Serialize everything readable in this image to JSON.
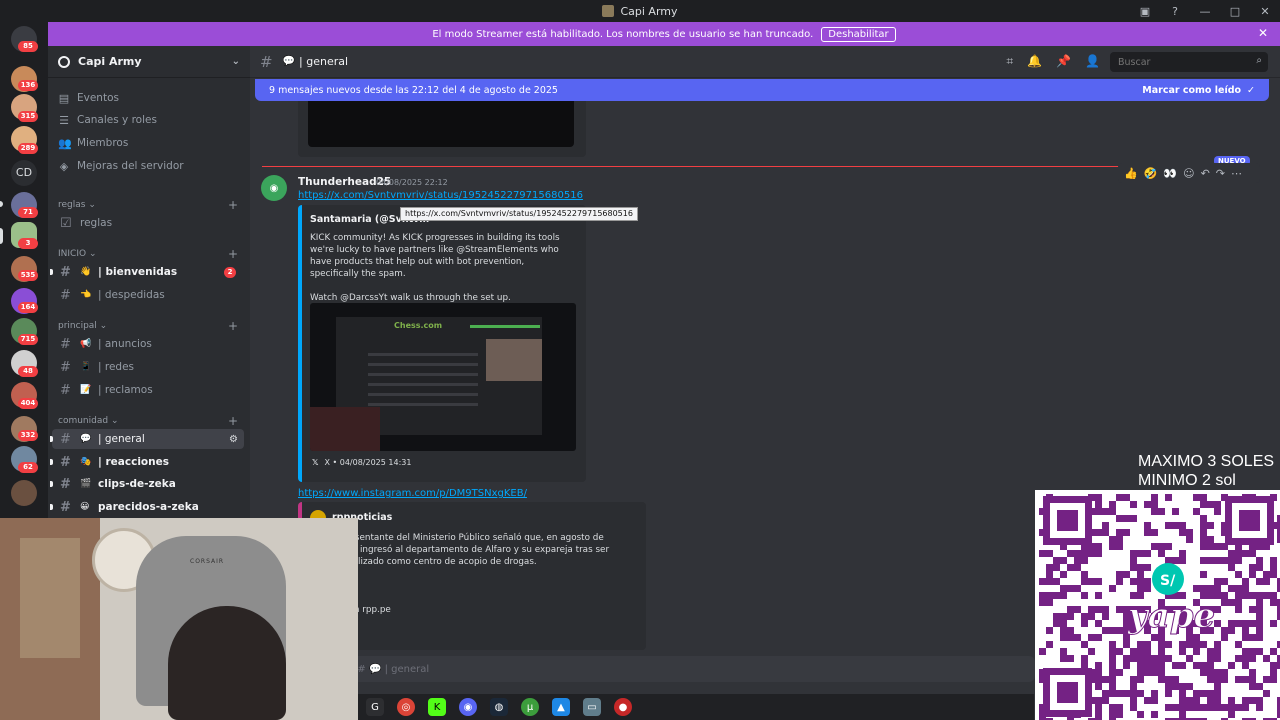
{
  "window": {
    "title": "Capi Army"
  },
  "banner": {
    "text": "El modo Streamer está habilitado. Los nombres de usuario se han truncado.",
    "button": "Deshabilitar"
  },
  "server_rail": {
    "badges": [
      "85",
      "136",
      "315",
      "289",
      "71",
      "3",
      "535",
      "164",
      "715",
      "48",
      "404",
      "332",
      "62"
    ],
    "cd_label": "CD"
  },
  "sidebar": {
    "server_name": "Capi Army",
    "nav": [
      "Eventos",
      "Canales y roles",
      "Miembros",
      "Mejoras del servidor"
    ],
    "categories": {
      "reglas": {
        "label": "reglas",
        "channels": [
          {
            "name": "reglas"
          }
        ]
      },
      "inicio": {
        "label": "INICIO",
        "channels": [
          {
            "emoji": "👋",
            "name": "| bienvenidas",
            "badge": "2"
          },
          {
            "emoji": "👈",
            "name": "| despedidas"
          }
        ]
      },
      "principal": {
        "label": "principal",
        "channels": [
          {
            "emoji": "📢",
            "name": "| anuncios"
          },
          {
            "emoji": "📱",
            "name": "| redes"
          },
          {
            "emoji": "📝",
            "name": "| reclamos"
          }
        ]
      },
      "comunidad": {
        "label": "comunidad",
        "channels": [
          {
            "emoji": "💬",
            "name": "| general"
          },
          {
            "emoji": "🎭",
            "name": "| reacciones"
          },
          {
            "emoji": "🎬",
            "name": "clips-de-zeka"
          },
          {
            "emoji": "😀",
            "name": "parecidos-a-zeka"
          }
        ]
      }
    }
  },
  "header": {
    "channel_emoji": "💬",
    "channel_name": "| general",
    "search_placeholder": "Buscar"
  },
  "new_messages_bar": {
    "text": "9 mensajes nuevos desde las 22:12 del 4 de agosto de 2025",
    "mark_read": "Marcar como leído"
  },
  "message": {
    "author": "Thunderhead25",
    "timestamp": "04/08/2025 22:12",
    "link1": "https://x.com/Svntvmvriv/status/1952452279715680516",
    "tooltip": "https://x.com/Svntvmvriv/status/1952452279715680516",
    "embed1": {
      "author": "Santamaria (@Svntvm",
      "paragraph1": "KICK community! As KICK progresses in building its tools we're lucky to have partners like @StreamElements who have products that help out with bot prevention, specifically the spam.",
      "paragraph2": "Watch @DarcssYt walk us through the set up.",
      "image_logo": "Chess.com",
      "footer": "X • 04/08/2025 14:31"
    },
    "link2": "https://www.instagram.com/p/DM9TSNxgKEB/",
    "embed2": {
      "author": "rppnoticias",
      "line1": "o, el representante del Ministerio Público señaló que, en agosto de",
      "line2": "nal policial ingresó al departamento de Alfaro y su expareja tras ser",
      "line3": "que era utilizado como centro de acopio de drogas.",
      "line4": "o Público",
      "line5": "rmación en rpp.pe"
    },
    "new_label": "NUEVO"
  },
  "composer": {
    "placeholder": "je a # 💬 | general"
  },
  "overlay": {
    "line1": "MAXIMO 3 SOLES",
    "line2": "MINIMO 2 sol",
    "webcam_brand": "CORSAIR"
  },
  "colors": {
    "banner": "#9b4dd7",
    "new_bar": "#5865f2",
    "link": "#00a8fc",
    "qr_purple": "#742284"
  }
}
